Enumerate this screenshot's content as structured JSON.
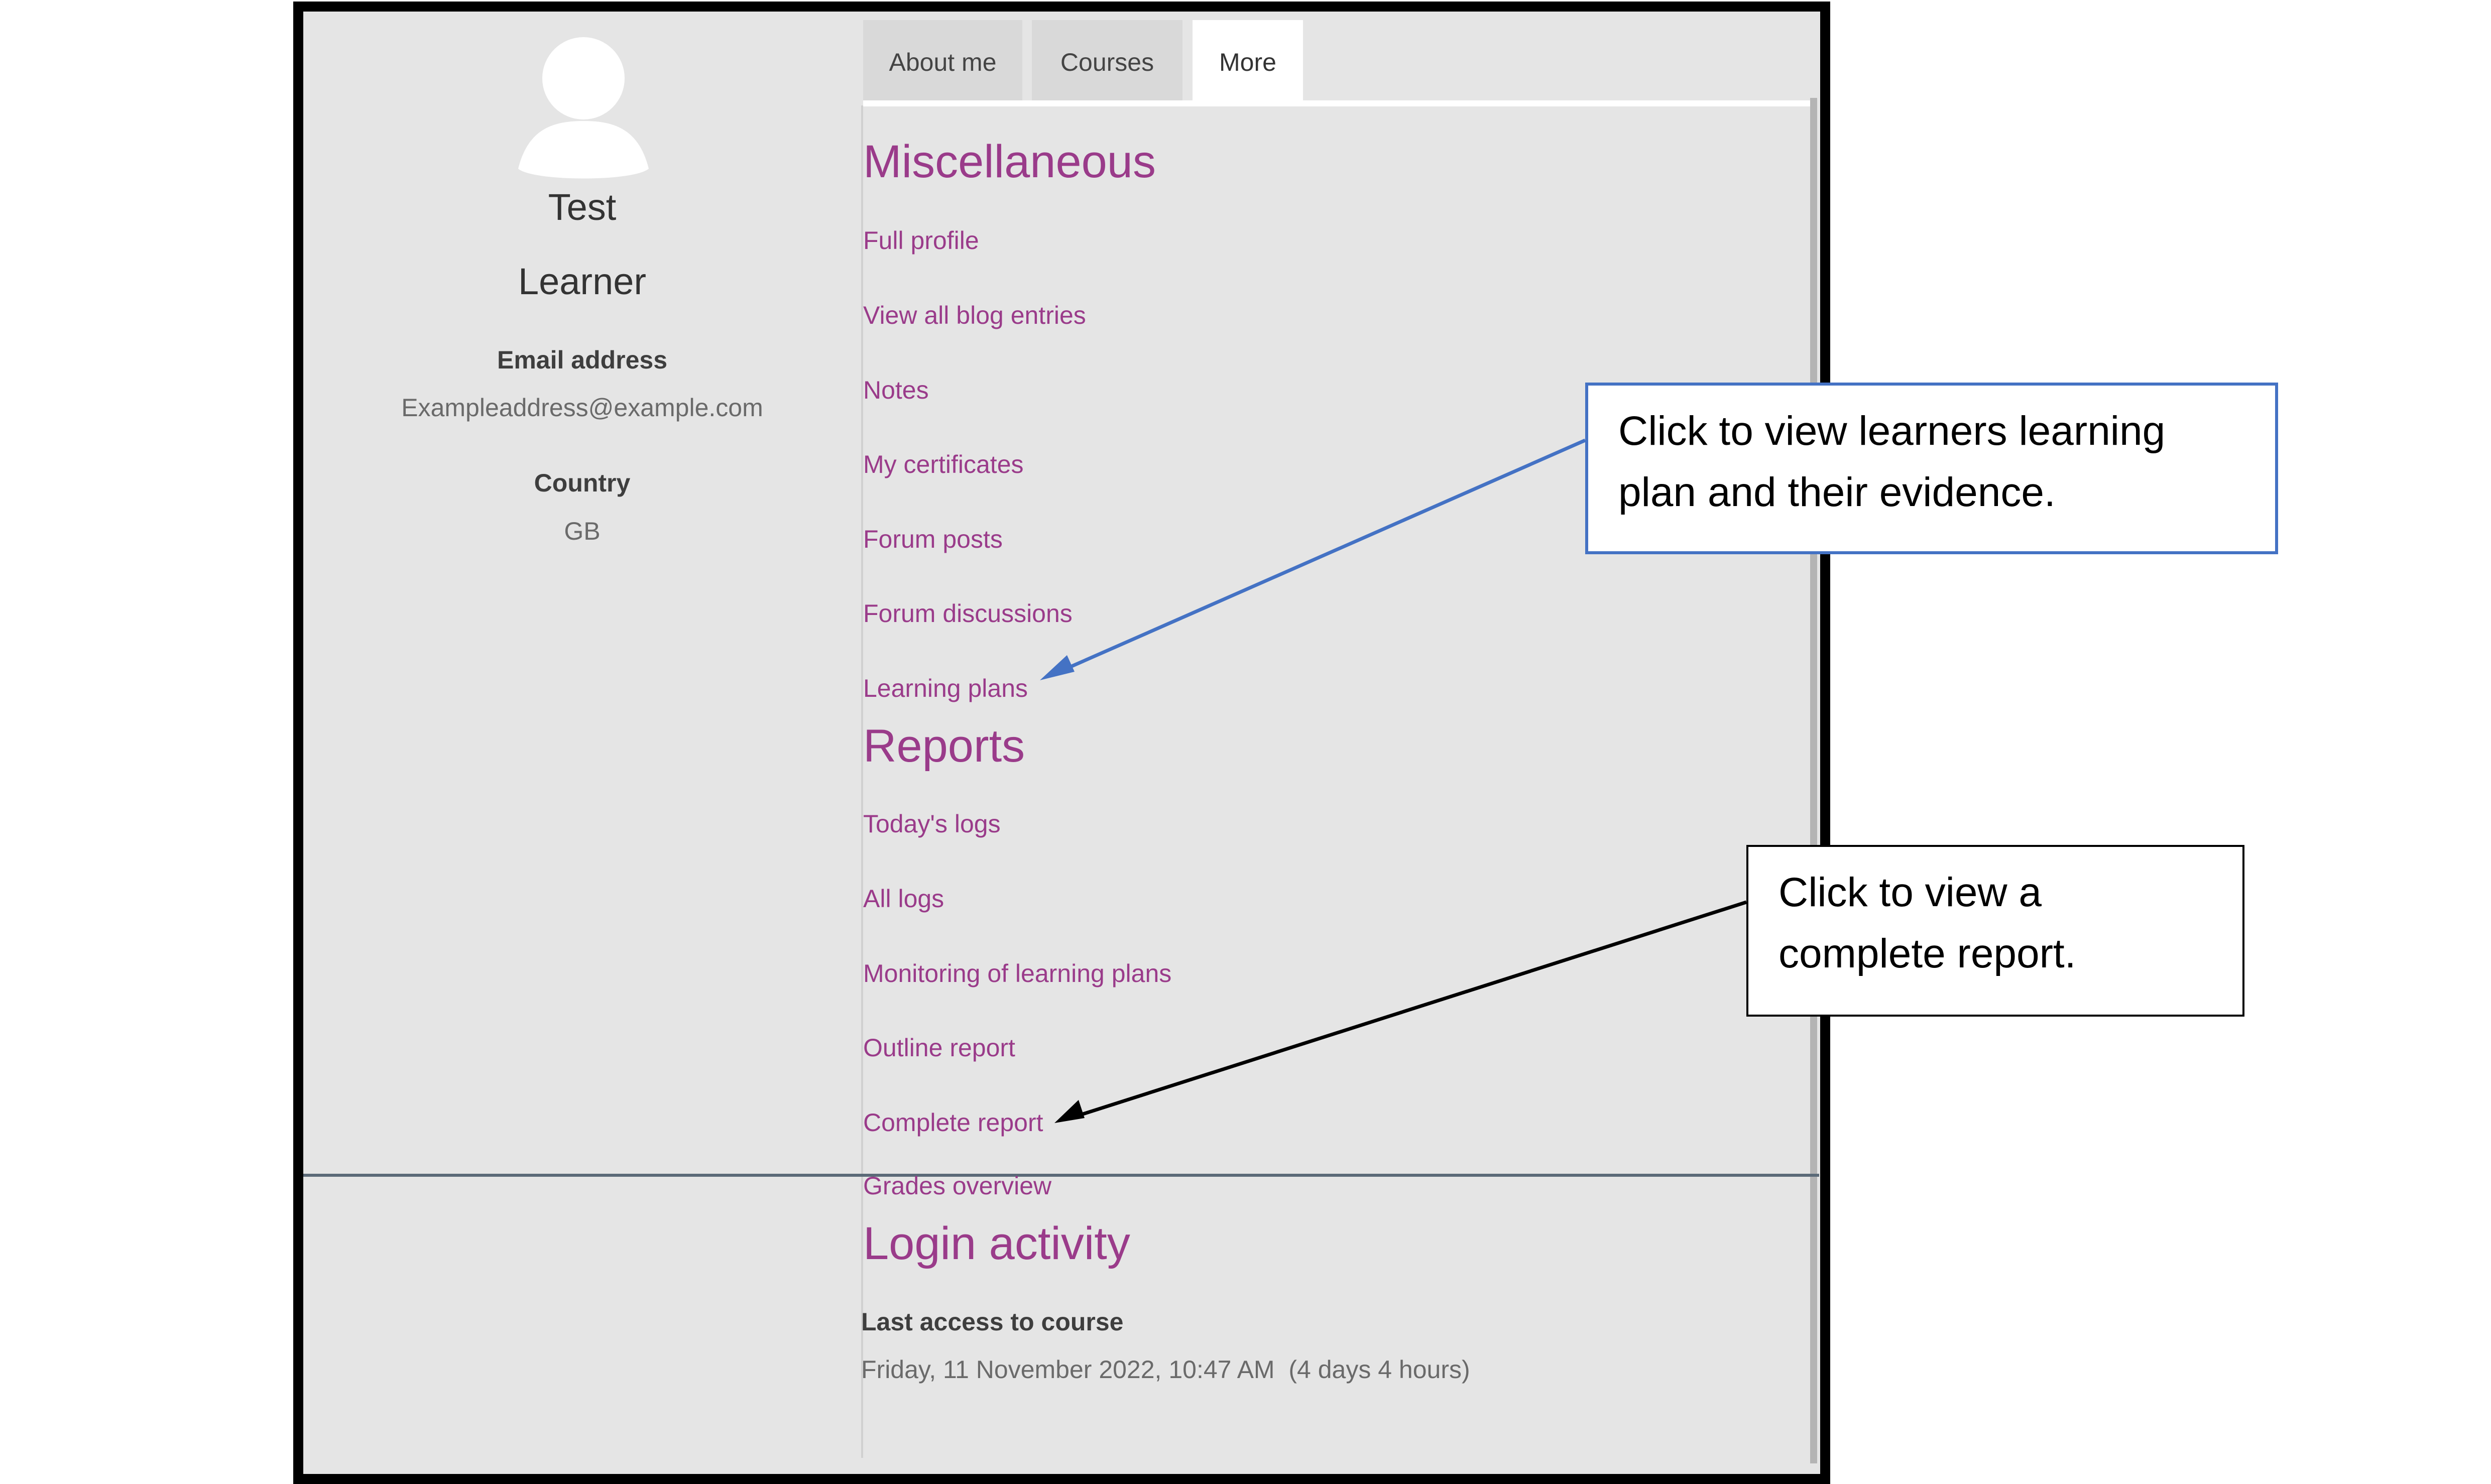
{
  "profile": {
    "first_name": "Test",
    "last_name": "Learner",
    "email_label": "Email address",
    "email_value": "Exampleaddress@example.com",
    "country_label": "Country",
    "country_value": "GB",
    "avatar_icon": "user-avatar-icon"
  },
  "tabs": [
    {
      "label": "About me"
    },
    {
      "label": "Courses"
    },
    {
      "label": "More",
      "active": true
    }
  ],
  "miscellaneous": {
    "heading": "Miscellaneous",
    "links": [
      "Full profile",
      "View all blog entries",
      "Notes",
      "My certificates",
      "Forum posts",
      "Forum discussions",
      "Learning plans"
    ]
  },
  "reports": {
    "heading": "Reports",
    "links": [
      "Today's logs",
      "All logs",
      "Monitoring of learning plans",
      "Outline report",
      "Complete report",
      "Grades overview"
    ]
  },
  "login_activity": {
    "heading": "Login activity",
    "last_access_label": "Last access to course",
    "last_access_value": "Friday, 11 November 2022, 10:47 AM  (4 days 4 hours)"
  },
  "callouts": {
    "learning_plans": "Click to view learners learning plan and their evidence.",
    "complete_report": "Click to view a complete report."
  },
  "colors": {
    "link": "#9a3b8a",
    "panel": "#e5e5e5",
    "blue_arrow": "#4472c4"
  }
}
